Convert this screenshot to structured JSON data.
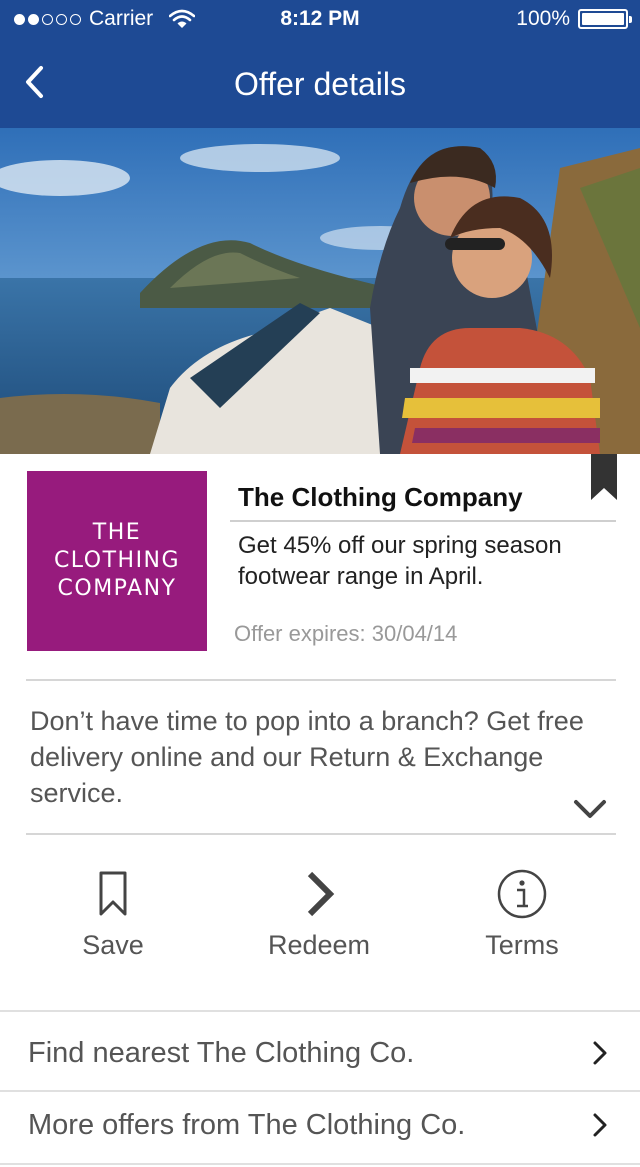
{
  "status_bar": {
    "carrier": "Carrier",
    "time": "8:12 PM",
    "battery": "100%",
    "signal_bars_filled": 2,
    "signal_bars_total": 5
  },
  "nav": {
    "title": "Offer details",
    "back_icon": "chevron-left-icon"
  },
  "hero": {
    "description_icon": "hero-photo"
  },
  "offer": {
    "logo_lines": [
      "THE",
      "CLOTHING",
      "COMPANY"
    ],
    "logo_color": "#971b7d",
    "company_name": "The Clothing Company",
    "text": "Get 45% off our spring season footwear range in April.",
    "expiry": "Offer expires: 30/04/14",
    "description": "Don’t have time to pop into a branch? Get free delivery online and our Return & Exchange service."
  },
  "actions": {
    "save": {
      "label": "Save",
      "icon": "bookmark-icon"
    },
    "redeem": {
      "label": "Redeem",
      "icon": "chevron-right-icon"
    },
    "terms": {
      "label": "Terms",
      "icon": "info-icon"
    }
  },
  "links": {
    "find_nearest": "Find nearest The Clothing Co.",
    "more_offers": "More offers from The Clothing Co."
  },
  "colors": {
    "nav_blue": "#1e4a94",
    "logo_purple": "#971b7d"
  }
}
